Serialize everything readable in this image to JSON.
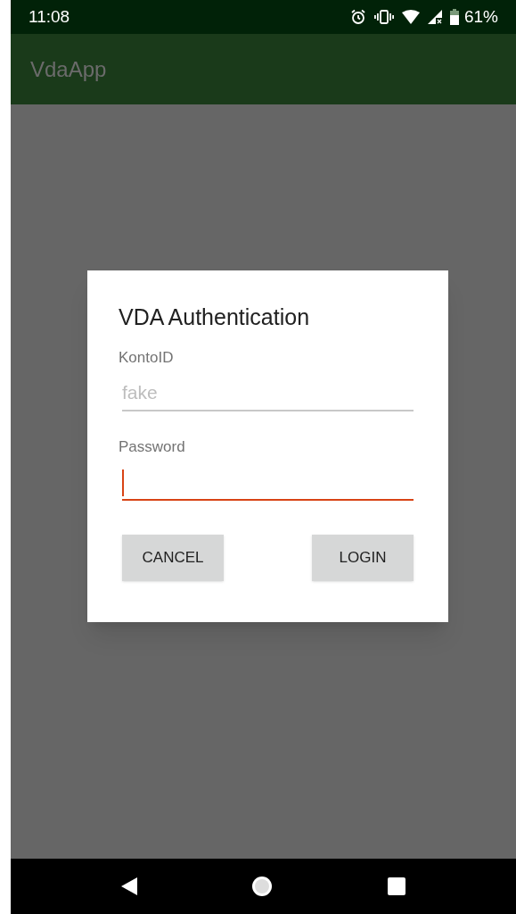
{
  "status_bar": {
    "time": "11:08",
    "battery": "61%"
  },
  "app_bar": {
    "title": "VdaApp"
  },
  "dialog": {
    "title": "VDA Authentication",
    "fields": [
      {
        "label": "KontoID",
        "placeholder": "fake",
        "focused": false
      },
      {
        "label": "Password",
        "focused": true
      }
    ],
    "buttons": [
      "CANCEL",
      "LOGIN"
    ]
  }
}
